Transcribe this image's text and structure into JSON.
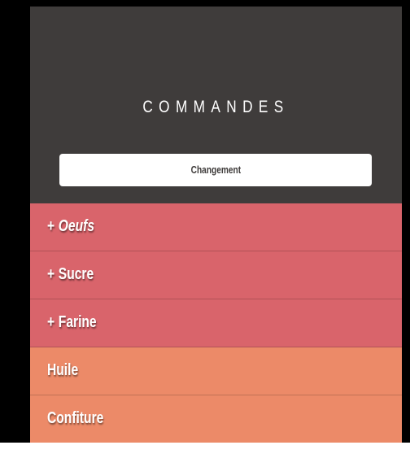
{
  "header": {
    "title": "COMMANDES",
    "change_button_label": "Changement"
  },
  "items": [
    {
      "prefix": "+",
      "label": "Oeufs",
      "italic": true,
      "color": "#d9646b"
    },
    {
      "prefix": "+",
      "label": "Sucre",
      "italic": false,
      "color": "#d9646b"
    },
    {
      "prefix": "+",
      "label": "Farine",
      "italic": false,
      "color": "#d9646b"
    },
    {
      "prefix": "",
      "label": "Huile",
      "italic": false,
      "color": "#ec8a68"
    },
    {
      "prefix": "",
      "label": "Confiture",
      "italic": false,
      "color": "#ec8a68"
    }
  ],
  "colors": {
    "header_bg": "#3f3c3b",
    "page_bg": "#000000",
    "selected_row": "#d9646b",
    "unselected_row": "#ec8a68"
  }
}
